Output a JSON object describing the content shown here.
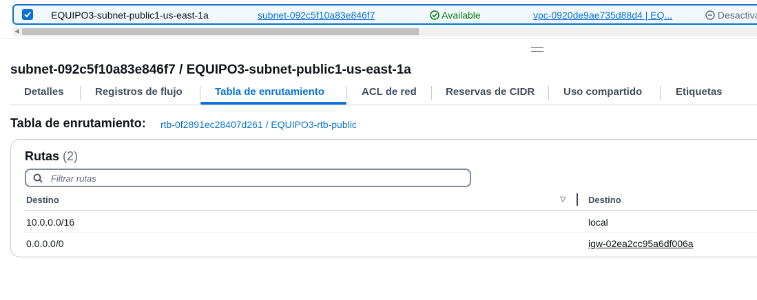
{
  "selected_row": {
    "name": "EQUIPO3-subnet-public1-us-east-1a",
    "subnet_id": "subnet-092c5f10a83e846f7",
    "state": "Available",
    "vpc": "vpc-0920de9ae735d88d4 | EQ...",
    "extra": "Desactiva"
  },
  "page_title": "subnet-092c5f10a83e846f7 / EQUIPO3-subnet-public1-us-east-1a",
  "tabs": [
    {
      "label": "Detalles"
    },
    {
      "label": "Registros de flujo"
    },
    {
      "label": "Tabla de enrutamiento"
    },
    {
      "label": "ACL de red"
    },
    {
      "label": "Reservas de CIDR"
    },
    {
      "label": "Uso compartido"
    },
    {
      "label": "Etiquetas"
    }
  ],
  "route_table": {
    "label": "Tabla de enrutamiento:",
    "link": "rtb-0f2891ec28407d261 / EQUIPO3-rtb-public"
  },
  "routes": {
    "title": "Rutas",
    "count": "(2)",
    "filter_placeholder": "Filtrar rutas",
    "columns": [
      "Destino",
      "Destino"
    ],
    "rows": [
      {
        "destination": "10.0.0.0/16",
        "target": "local"
      },
      {
        "destination": "0.0.0.0/0",
        "target": "igw-02ea2cc95a6df006a"
      }
    ]
  },
  "colors": {
    "accent": "#0972d3",
    "available": "#037f0c",
    "text": "#0f141a"
  },
  "icons": [
    "checkbox-checked-icon",
    "status-available-icon",
    "status-disabled-icon",
    "search-icon",
    "sort-descending-icon",
    "drag-handle-icon",
    "scroll-left-icon"
  ]
}
